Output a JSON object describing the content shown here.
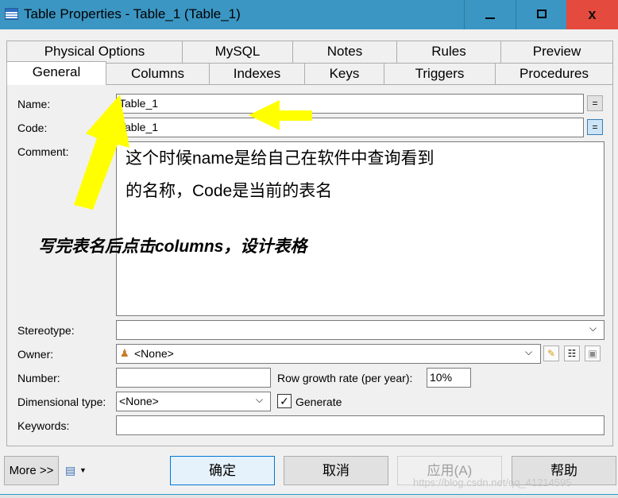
{
  "window": {
    "title": "Table Properties - Table_1 (Table_1)",
    "close_glyph": "x"
  },
  "tabs_top": [
    "Physical Options",
    "MySQL",
    "Notes",
    "Rules",
    "Preview"
  ],
  "tabs_bottom": [
    "General",
    "Columns",
    "Indexes",
    "Keys",
    "Triggers",
    "Procedures"
  ],
  "active_tab": "General",
  "form": {
    "name_label": "Name:",
    "name_value": "Table_1",
    "code_label": "Code:",
    "code_value": "Table_1",
    "eq_button": "=",
    "comment_label": "Comment:",
    "comment_value": "",
    "stereotype_label": "Stereotype:",
    "stereotype_value": "",
    "owner_label": "Owner:",
    "owner_value": "<None>",
    "number_label": "Number:",
    "number_value": "",
    "row_growth_label": "Row growth rate (per year):",
    "row_growth_value": "10%",
    "dimensional_label": "Dimensional type:",
    "dimensional_value": "<None>",
    "generate_label": "Generate",
    "generate_checked": true,
    "keywords_label": "Keywords:",
    "keywords_value": ""
  },
  "annotations": {
    "line1": "这个时候name是给自己在软件中查询看到",
    "line2": "的名称，Code是当前的表名",
    "line3": "写完表名后点击columns，设计表格",
    "arrow_color": "#ffff00"
  },
  "footer": {
    "more_label": "More >>",
    "ok_label": "确定",
    "cancel_label": "取消",
    "apply_label": "应用(A)",
    "help_label": "帮助",
    "watermark": "https://blog.csdn.net/qq_41214595"
  },
  "colors": {
    "titlebar": "#3b96c3",
    "close_button": "#e54a3e",
    "primary_border": "#0078d7"
  }
}
